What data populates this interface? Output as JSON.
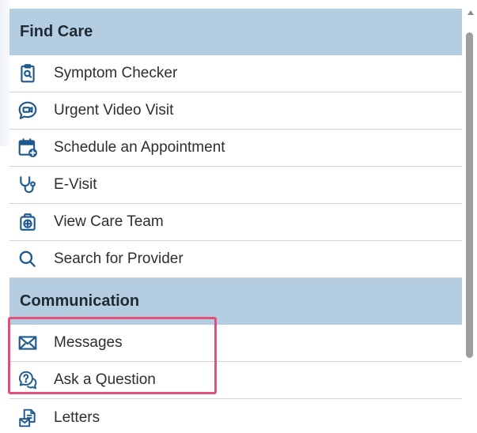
{
  "sections": [
    {
      "title": "Find Care",
      "items": [
        {
          "label": "Symptom Checker",
          "icon": "clipboard-search-icon"
        },
        {
          "label": "Urgent Video Visit",
          "icon": "video-chat-icon"
        },
        {
          "label": "Schedule an Appointment",
          "icon": "calendar-add-icon"
        },
        {
          "label": "E-Visit",
          "icon": "stethoscope-icon"
        },
        {
          "label": "View Care Team",
          "icon": "medical-bag-icon"
        },
        {
          "label": "Search for Provider",
          "icon": "search-icon"
        }
      ]
    },
    {
      "title": "Communication",
      "items": [
        {
          "label": "Messages",
          "icon": "envelope-icon"
        },
        {
          "label": "Ask a Question",
          "icon": "question-chat-icon"
        },
        {
          "label": "Letters",
          "icon": "letters-icon"
        }
      ]
    }
  ],
  "colors": {
    "section_header_bg": "#b5cde1",
    "highlight_border": "#e2507a",
    "icon_color": "#1f5a8e"
  }
}
